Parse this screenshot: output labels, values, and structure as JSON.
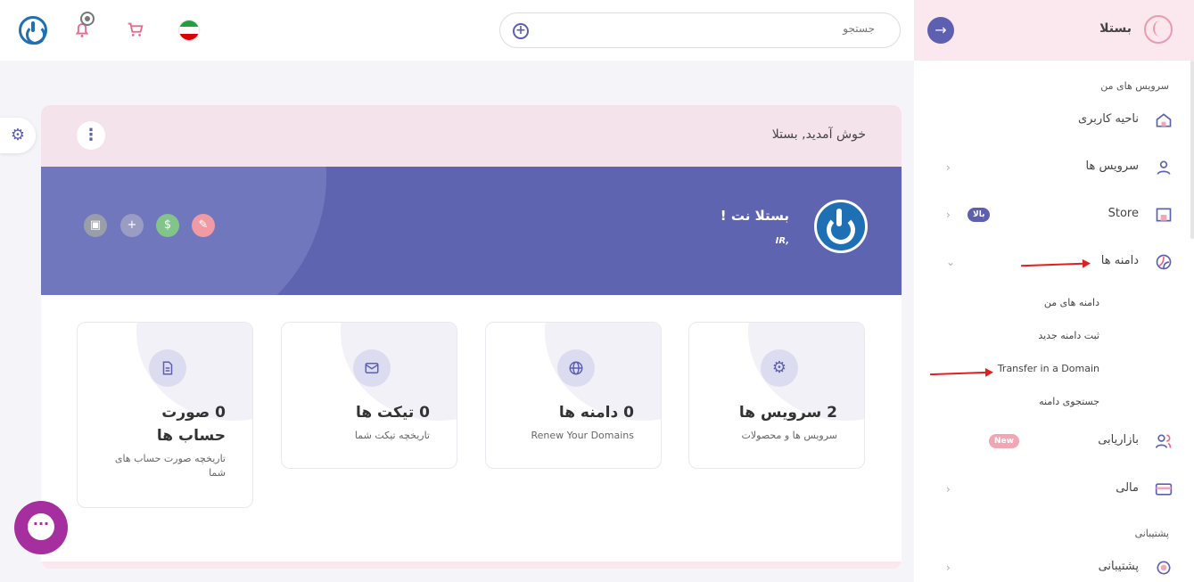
{
  "search": {
    "placeholder": "جستجو"
  },
  "sidebar": {
    "brand": "بستلا",
    "section_services": "سرویس های من",
    "section_support": "پشتیبانی",
    "items": [
      {
        "label": "ناحیه کاربری",
        "icon": "home-icon"
      },
      {
        "label": "سرویس ها",
        "icon": "user-icon"
      },
      {
        "label": "Store",
        "icon": "store-icon",
        "badge": "بالا"
      },
      {
        "label": "دامنه ها",
        "icon": "globe-icon"
      },
      {
        "label": "بازاریابی",
        "icon": "users-icon",
        "badge": "New"
      },
      {
        "label": "مالی",
        "icon": "credit-card-icon"
      },
      {
        "label": "پشتیبانی",
        "icon": "headset-icon"
      }
    ],
    "domain_sub": [
      "دامنه های من",
      "ثبت دامنه جدید",
      "Transfer in a Domain",
      "جستجوی دامنه"
    ]
  },
  "main": {
    "welcome": "خوش آمدید, بستلا",
    "banner_name": "بستلا نت !",
    "banner_ir": "IR,",
    "stats": [
      {
        "title": "2 سرویس ها",
        "subtitle": "سرویس ها و محصولات",
        "icon": "gear-icon"
      },
      {
        "title": "0 دامنه ها",
        "subtitle": "Renew Your Domains",
        "icon": "globe-icon"
      },
      {
        "title": "0 تیکت ها",
        "subtitle": "تاریخچه تیکت شما",
        "icon": "mail-icon"
      },
      {
        "title": "0 صورت حساب ها",
        "subtitle": "تاریخچه صورت حساب های شما",
        "icon": "document-icon"
      }
    ]
  },
  "colors": {
    "accent": "#5d5fb0",
    "banner": "#5f64b0",
    "pink": "#fbe7ee",
    "chat": "#a62fa0"
  }
}
